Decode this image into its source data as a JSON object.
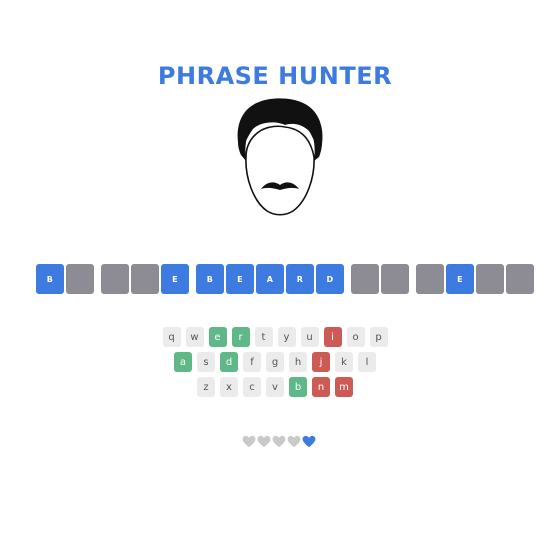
{
  "title": "PHRASE HUNTER",
  "phrase": {
    "words": [
      [
        "B",
        "",
        "",
        "",
        "E",
        "B",
        "E",
        "A",
        "R",
        "D",
        "",
        "",
        "",
        "E",
        "",
        ""
      ],
      []
    ],
    "tiles": [
      {
        "letter": "B",
        "shown": true
      },
      {
        "letter": "",
        "shown": false
      },
      null,
      {
        "letter": "",
        "shown": false
      },
      {
        "letter": "",
        "shown": false
      },
      {
        "letter": "E",
        "shown": true
      },
      null,
      {
        "letter": "B",
        "shown": true
      },
      {
        "letter": "E",
        "shown": true
      },
      {
        "letter": "A",
        "shown": true
      },
      {
        "letter": "R",
        "shown": true
      },
      {
        "letter": "D",
        "shown": true
      },
      null,
      {
        "letter": "",
        "shown": false
      },
      {
        "letter": "",
        "shown": false
      },
      null,
      {
        "letter": "",
        "shown": false
      },
      {
        "letter": "E",
        "shown": true
      },
      {
        "letter": "",
        "shown": false
      },
      {
        "letter": "",
        "shown": false
      }
    ]
  },
  "keyboard": {
    "rows": [
      [
        {
          "key": "q",
          "state": "unused"
        },
        {
          "key": "w",
          "state": "unused"
        },
        {
          "key": "e",
          "state": "correct"
        },
        {
          "key": "r",
          "state": "correct"
        },
        {
          "key": "t",
          "state": "unused"
        },
        {
          "key": "y",
          "state": "unused"
        },
        {
          "key": "u",
          "state": "unused"
        },
        {
          "key": "i",
          "state": "wrong"
        },
        {
          "key": "o",
          "state": "unused"
        },
        {
          "key": "p",
          "state": "unused"
        }
      ],
      [
        {
          "key": "a",
          "state": "correct"
        },
        {
          "key": "s",
          "state": "unused"
        },
        {
          "key": "d",
          "state": "correct"
        },
        {
          "key": "f",
          "state": "unused"
        },
        {
          "key": "g",
          "state": "unused"
        },
        {
          "key": "h",
          "state": "unused"
        },
        {
          "key": "j",
          "state": "wrong"
        },
        {
          "key": "k",
          "state": "unused"
        },
        {
          "key": "l",
          "state": "unused"
        }
      ],
      [
        {
          "key": "z",
          "state": "unused"
        },
        {
          "key": "x",
          "state": "unused"
        },
        {
          "key": "c",
          "state": "unused"
        },
        {
          "key": "v",
          "state": "unused"
        },
        {
          "key": "b",
          "state": "correct"
        },
        {
          "key": "n",
          "state": "wrong"
        },
        {
          "key": "m",
          "state": "wrong"
        }
      ]
    ]
  },
  "lives": {
    "total": 5,
    "remaining": 1,
    "colors": {
      "lost": "#c9c9c9",
      "remaining": "#3d7be0"
    }
  },
  "colors": {
    "accent": "#3d7be0",
    "hidden_tile": "#8d8c95",
    "correct_key": "#5eb887",
    "wrong_key": "#cd5b55",
    "unused_key": "#ebebeb"
  }
}
